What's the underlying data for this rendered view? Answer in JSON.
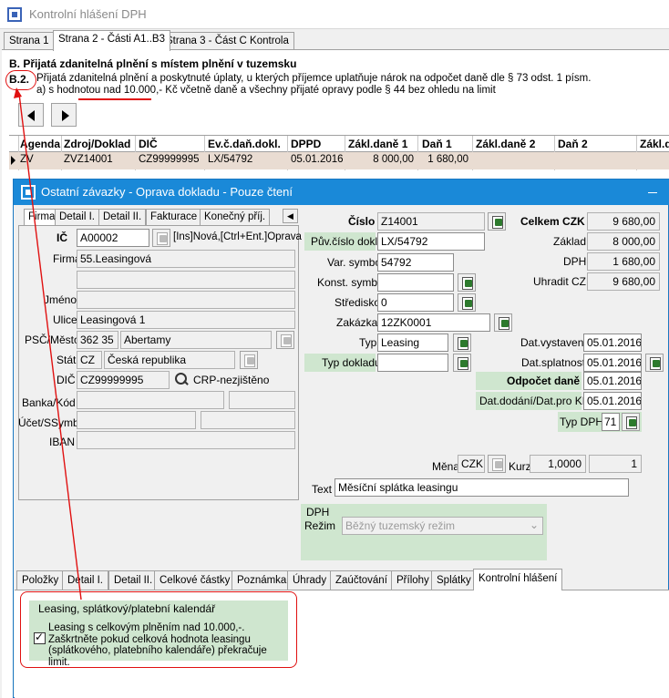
{
  "outer_window": {
    "title": "Kontrolní hlášení DPH",
    "tabs": [
      "Strana 1",
      "Strana 2 - Části A1..B3",
      "Strana 3 - Část C Kontrola"
    ],
    "active_tab": 1
  },
  "section": {
    "title": "B. Přijatá zdanitelná plnění s místem plnění v tuzemsku",
    "code": "B.2.",
    "description": "Přijatá zdanitelná plnění a poskytnuté úplaty, u kterých příjemce uplatňuje nárok na odpočet daně dle § 73 odst. 1 písm. a) s hodnotou nad 10.000,- Kč včetně daně a všechny přijaté opravy podle § 44 bez ohledu na limit"
  },
  "grid": {
    "columns": [
      "Agenda",
      "Zdroj/Doklad",
      "DIČ",
      "Ev.č.daň.dokl.",
      "DPPD",
      "Zákl.daně 1",
      "Daň 1",
      "Zákl.daně 2",
      "Daň 2",
      "Zákl.d"
    ],
    "row": [
      "ZV",
      "ZVZ14001",
      "CZ99999995",
      "LX/54792",
      "05.01.2016",
      "8 000,00",
      "1 680,00",
      "",
      "",
      ""
    ]
  },
  "dialog": {
    "title": "Ostatní závazky - Oprava dokladu - Pouze čtení",
    "left_tabs": [
      "Firma",
      "Detail I.",
      "Detail II.",
      "Fakturace",
      "Konečný příj."
    ],
    "left": {
      "ic_label": "IČ",
      "ic_value": "A00002",
      "ic_hint": "[Ins]Nová,[Ctrl+Ent.]Oprava",
      "firma_label": "Firma",
      "firma_value": "55.Leasingová",
      "jmeno_label": "Jméno",
      "jmeno_value": "",
      "ulice_label": "Ulice",
      "ulice_value": "Leasingová 1",
      "psc_label": "PSČ/Město",
      "psc_value": "362 35",
      "mesto_value": "Abertamy",
      "stat_label": "Stát",
      "stat_code": "CZ",
      "stat_name": "Česká republika",
      "dic_label": "DIČ",
      "dic_value": "CZ99999995",
      "crp_text": "CRP-nezjištěno",
      "banka_label": "Banka/Kód",
      "ucet_label": "Účet/SSymb",
      "iban_label": "IBAN"
    },
    "right": {
      "cislo_label": "Číslo",
      "cislo_value": "Z14001",
      "puv_label": "Pův.číslo dokl.",
      "puv_value": "LX/54792",
      "var_label": "Var. symbol",
      "var_value": "54792",
      "konst_label": "Konst. symbol",
      "konst_value": "",
      "stredisko_label": "Středisko",
      "stredisko_value": "0",
      "zakazka_label": "Zakázka",
      "zakazka_value": "12ZK0001",
      "typ_label": "Typ",
      "typ_value": "Leasing",
      "typdokl_label": "Typ dokladu",
      "typdokl_value": "",
      "mena_label": "Měna",
      "mena_value": "CZK",
      "kurz_label": "Kurz",
      "kurz_value": "1,0000",
      "kurz_qty": "1",
      "text_label": "Text",
      "text_value": "Měsíční splátka leasingu"
    },
    "totals": {
      "celkem_label": "Celkem CZK",
      "celkem_value": "9 680,00",
      "zaklad_label": "Základ",
      "zaklad_value": "8 000,00",
      "dph_label": "DPH",
      "dph_value": "1 680,00",
      "uhradit_label": "Uhradit CZK",
      "uhradit_value": "9 680,00"
    },
    "dates": {
      "vystaveni_label": "Dat.vystavení",
      "vystaveni_value": "05.01.2016",
      "splatnosti_label": "Dat.splatnosti",
      "splatnosti_value": "05.01.2016",
      "odpocet_label": "Odpočet daně",
      "odpocet_value": "05.01.2016",
      "dodani_label": "Dat.dodání/Dat.pro KH",
      "dodani_value": "05.01.2016",
      "typdph_label": "Typ DPH",
      "typdph_value": "71"
    },
    "dph_box": {
      "label_top": "DPH",
      "label_bottom": "Režim",
      "select_value": "Běžný tuzemský režim"
    },
    "bottom_tabs": [
      "Položky",
      "Detail I.",
      "Detail II.",
      "Celkové částky",
      "Poznámka",
      "Úhrady",
      "Zaúčtování",
      "Přílohy",
      "Splátky",
      "Kontrolní hlášení"
    ],
    "kh_panel": {
      "group_title": "Leasing, splátkový/platební kalendář",
      "checkbox_text": "Leasing s celkovým plněním nad 10.000,-. Zaškrtněte pokud celková hodnota leasingu (splátkového, platebního kalendáře) překračuje limit.",
      "checked": true
    }
  },
  "colors": {
    "dialog_title": "#1a89d8",
    "green_label": "#cfe6cf",
    "annotation": "#e01010",
    "row_highlight": "#e9dcd2"
  }
}
